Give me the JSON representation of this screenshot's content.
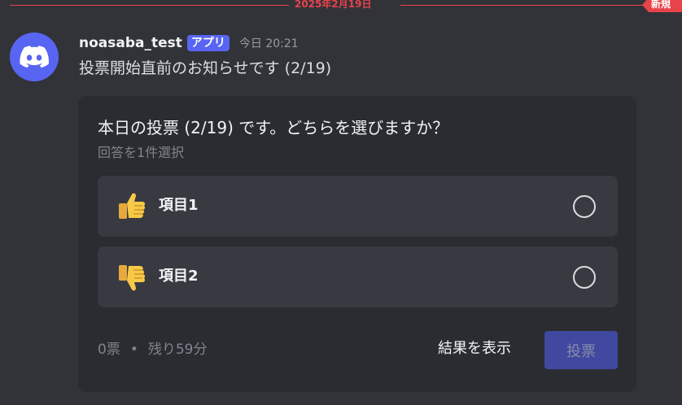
{
  "divider": {
    "date": "2025年2月19日",
    "new_label": "新規",
    "color": "#e8434a"
  },
  "message": {
    "avatar_icon": "discord-logo-icon",
    "username": "noasaba_test",
    "app_tag": "アプリ",
    "timestamp": "今日 20:21",
    "text": "投票開始直前のお知らせです (2/19)"
  },
  "poll": {
    "question": "本日の投票 (2/19) です。どちらを選びますか？",
    "subtitle": "回答を1件選択",
    "options": [
      {
        "icon": "thumbs-up-icon",
        "label": "項目1"
      },
      {
        "icon": "thumbs-down-icon",
        "label": "項目2"
      }
    ],
    "votes": "0票",
    "separator": "•",
    "remaining": "残り59分",
    "show_results_label": "結果を表示",
    "vote_label": "投票"
  }
}
